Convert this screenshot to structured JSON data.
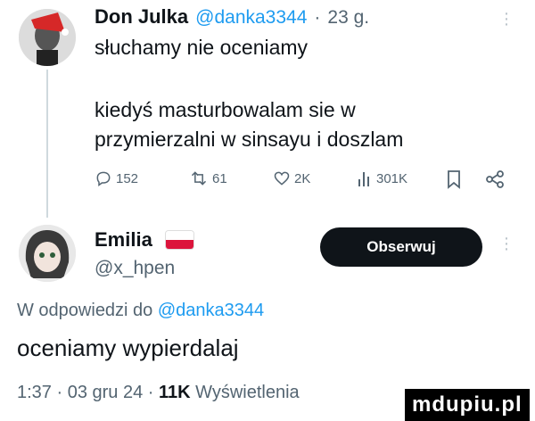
{
  "tweet1": {
    "name": "Don Julka",
    "handle": "@danka3344",
    "sep": "·",
    "time": "23 g.",
    "line1": "słuchamy nie oceniamy",
    "line2": "kiedyś masturbowalam sie w",
    "line3": "przymierzalni w sinsayu i doszlam",
    "actions": {
      "replies": "152",
      "retweets": "61",
      "likes": "2K",
      "views": "301K"
    }
  },
  "tweet2": {
    "name": "Emilia",
    "handle": "@x_hpen",
    "follow_label": "Obserwuj",
    "reply_prefix": "W odpowiedzi do",
    "reply_to": "@danka3344",
    "text": "oceniamy wypierdalaj",
    "meta_time": "1:37 · 03 gru 24 ·",
    "meta_views": "11K",
    "meta_views_label": "Wyświetlenia"
  },
  "watermark": "mdupiu.pl",
  "colors": {
    "text": "#0f1419",
    "secondary": "#536471",
    "link": "#1d9bf0",
    "button": "#0f1419",
    "flag_white": "#ffffff",
    "flag_red": "#dc143c"
  },
  "icons": [
    "more-icon",
    "reply-icon",
    "retweet-icon",
    "like-icon",
    "views-icon",
    "bookmark-icon",
    "share-icon",
    "poland-flag-icon"
  ]
}
